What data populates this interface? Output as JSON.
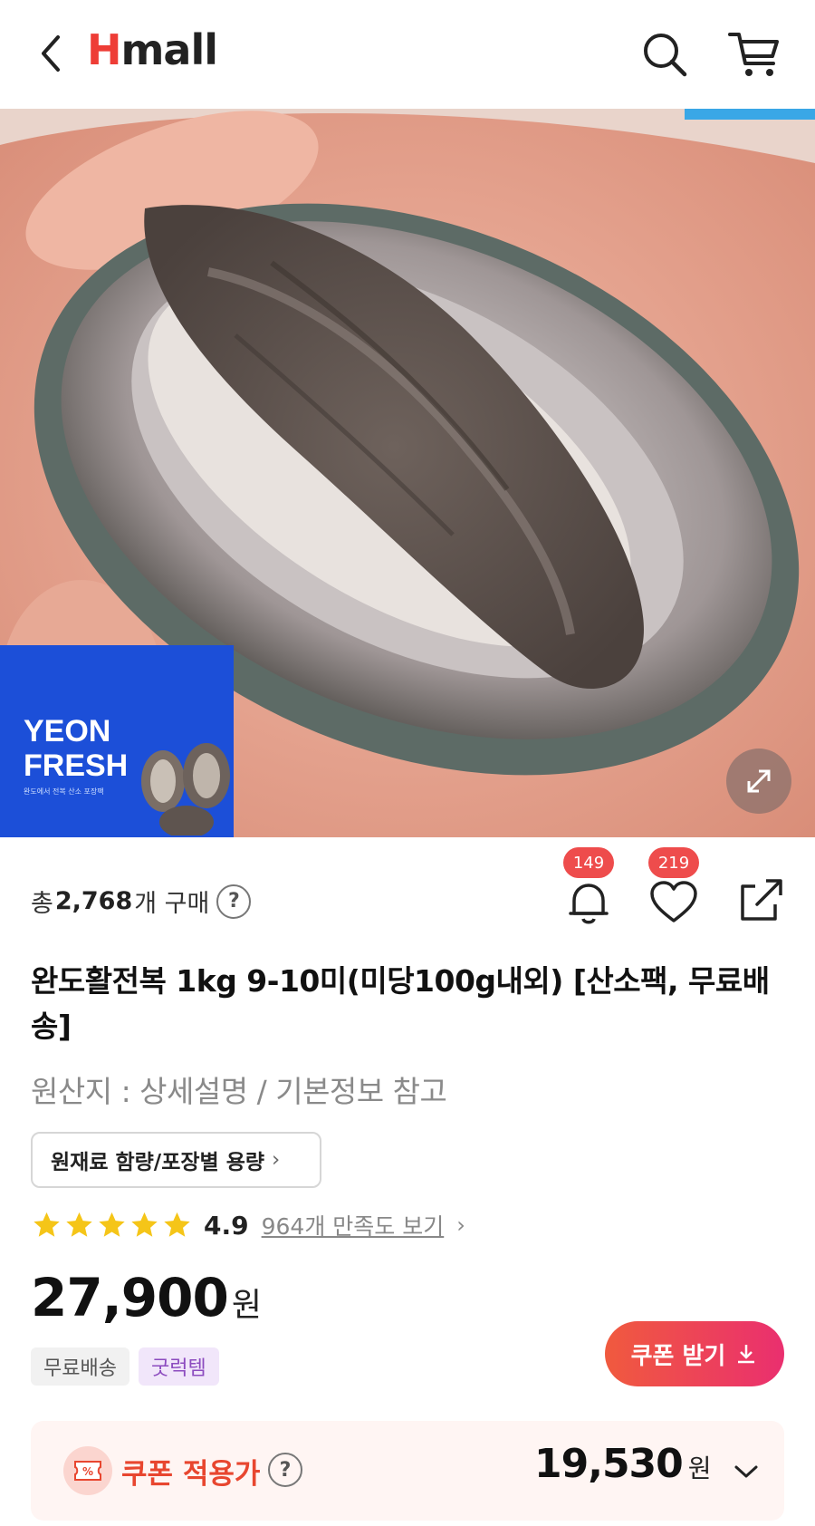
{
  "header": {
    "logo_h": "H",
    "logo_rest": "mall"
  },
  "hero": {
    "package_title_line1": "YEON",
    "package_title_line2": "FRESH",
    "package_sub1": "완도에서 전복 산소 포장팩",
    "package_sub2": "",
    "progress_fraction": 0.16
  },
  "product": {
    "purchase_prefix": "총",
    "purchase_count": "2,768",
    "purchase_suffix": "개 구매",
    "help_glyph": "?",
    "alert_count": "149",
    "wish_count": "219",
    "title": "완도활전복 1kg 9-10미(미당100g내외) [산소팩, 무료배송]",
    "origin": "원산지 : 상세설명 / 기본정보 참고",
    "ingredient_button": "원재료 함량/포장별 용량",
    "ingredient_chevron": "›",
    "rating": "4.9",
    "stars": 5,
    "review_link": "964개 만족도 보기",
    "review_chevron": "›",
    "price_value": "27,900",
    "price_unit": "원",
    "tags": [
      "무료배송",
      "굿럭템"
    ],
    "coupon_button": "쿠폰 받기"
  },
  "coupon_box": {
    "label": "쿠폰 적용가",
    "help_glyph": "?",
    "icon_glyph": "%",
    "price_value": "19,530",
    "price_unit": "원"
  },
  "colors": {
    "brand_red": "#ee3d36",
    "badge_red": "#ee4c4c",
    "star_yellow": "#f5c518",
    "coupon_red": "#e8462f",
    "progress_blue": "#3aa7e6"
  },
  "icons": [
    "back-icon",
    "search-icon",
    "cart-icon",
    "expand-icon",
    "bell-icon",
    "heart-icon",
    "share-icon",
    "star-icon",
    "download-icon",
    "coupon-percent-icon",
    "chevron-down-icon"
  ]
}
